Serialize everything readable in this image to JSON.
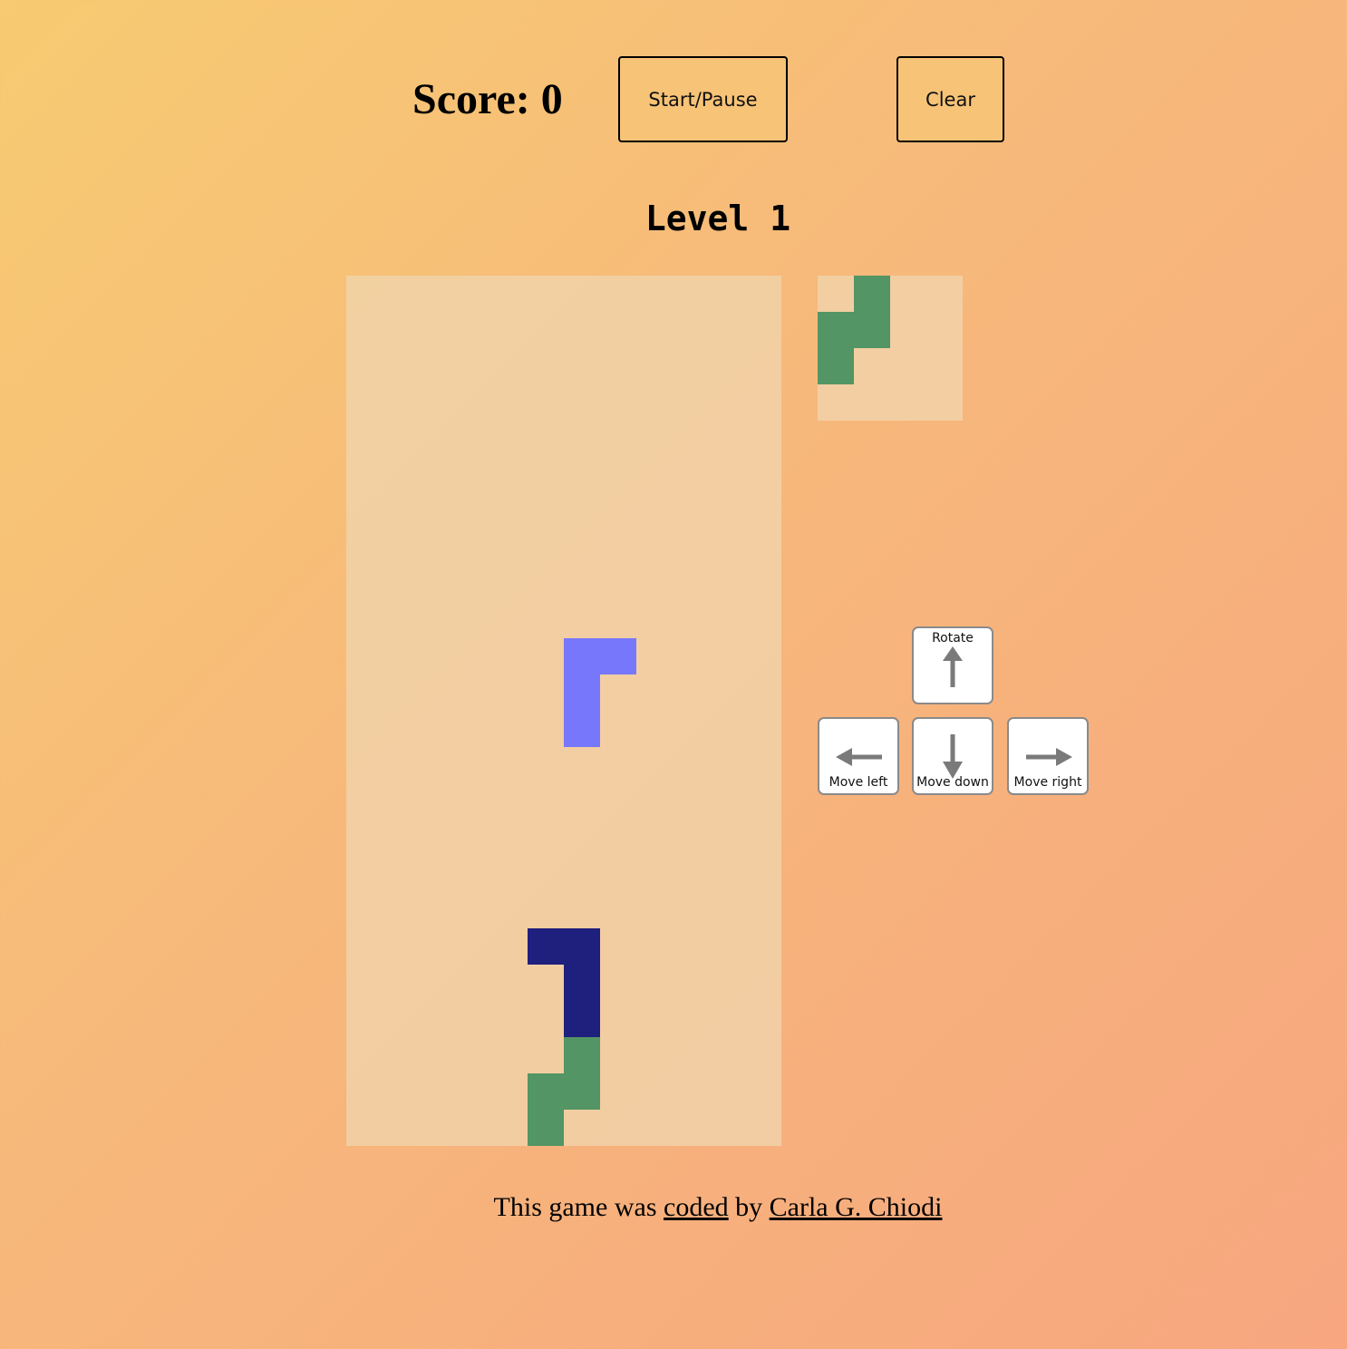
{
  "header": {
    "score_label": "Score: 0",
    "start_pause_label": "Start/Pause",
    "clear_label": "Clear"
  },
  "level_label": "Level 1",
  "colors": {
    "falling_piece": "#7777fb",
    "locked_j_piece": "#1f1f7e",
    "s_piece": "#539564",
    "board_background": "#f2cb9f",
    "arrow_gray": "#7a7a7a"
  },
  "board": {
    "columns": 12,
    "rows": 24,
    "falling_piece": {
      "color": "#7777fb",
      "cells": [
        [
          6,
          10
        ],
        [
          7,
          10
        ],
        [
          6,
          11
        ],
        [
          6,
          12
        ]
      ]
    },
    "locked_cells": [
      {
        "color": "#1f1f7e",
        "cells": [
          [
            5,
            18
          ],
          [
            6,
            18
          ],
          [
            6,
            19
          ],
          [
            6,
            20
          ]
        ]
      },
      {
        "color": "#539564",
        "cells": [
          [
            6,
            21
          ],
          [
            5,
            22
          ],
          [
            6,
            22
          ],
          [
            5,
            23
          ]
        ]
      }
    ]
  },
  "next_piece": {
    "columns": 4,
    "rows": 4,
    "color": "#539564",
    "cells": [
      [
        1,
        0
      ],
      [
        0,
        1
      ],
      [
        1,
        1
      ],
      [
        0,
        2
      ]
    ]
  },
  "controls": {
    "rotate_label": "Rotate",
    "move_left_label": "Move left",
    "move_down_label": "Move down",
    "move_right_label": "Move right"
  },
  "credit": {
    "prefix": "This game was ",
    "coded_link": "coded",
    "middle": " by ",
    "author_link": "Carla G. Chiodi"
  }
}
